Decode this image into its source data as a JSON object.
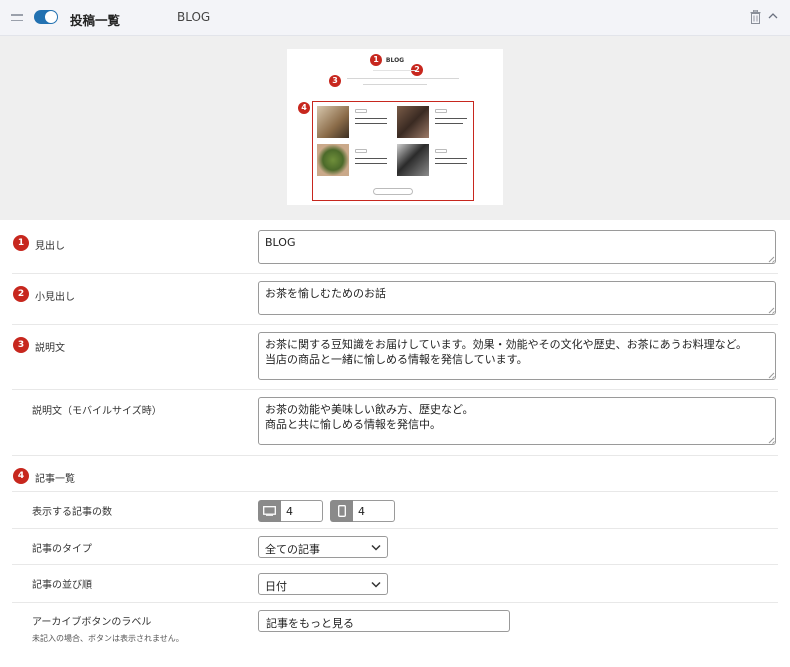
{
  "header": {
    "title": "投稿一覧",
    "subtitle": "BLOG",
    "toggle_on": true,
    "icons": [
      "drag-handle-icon",
      "toggle-switch",
      "trash-icon",
      "chevron-up-icon"
    ]
  },
  "preview": {
    "markers": [
      "1",
      "2",
      "3",
      "4"
    ],
    "heading": "BLOG"
  },
  "fields": {
    "heading": {
      "num": "1",
      "label": "見出し",
      "value": "BLOG"
    },
    "subheading": {
      "num": "2",
      "label": "小見出し",
      "value": "お茶を愉しむためのお話"
    },
    "description": {
      "num": "3",
      "label": "説明文",
      "value": "お茶に関する豆知識をお届けしています。効果・効能やその文化や歴史、お茶にあうお料理など。\n当店の商品と一緒に愉しめる情報を発信しています。"
    },
    "description_mobile": {
      "label": "説明文（モバイルサイズ時）",
      "value": "お茶の効能や美味しい飲み方、歴史など。\n商品と共に愉しめる情報を発信中。"
    }
  },
  "article_list": {
    "num": "4",
    "label": "記事一覧",
    "count": {
      "label": "表示する記事の数",
      "pc_value": "4",
      "sp_value": "4"
    },
    "type": {
      "label": "記事のタイプ",
      "value": "全ての記事"
    },
    "order": {
      "label": "記事の並び順",
      "value": "日付"
    },
    "archive": {
      "label": "アーカイブボタンのラベル",
      "value": "記事をもっと見る",
      "note": "未記入の場合、ボタンは表示されません。"
    }
  },
  "colors": {
    "accent": "#2271b1",
    "marker": "#c7271e",
    "header_bg": "#f3f4f8",
    "preview_bg": "#efefef"
  }
}
